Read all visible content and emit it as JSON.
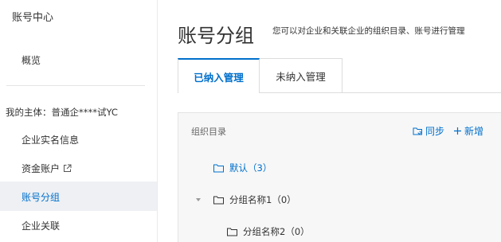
{
  "sidebar": {
    "title": "账号中心",
    "overview": "概览",
    "subject": "我的主体：普通企****试YC",
    "items": [
      {
        "label": "企业实名信息"
      },
      {
        "label": "资金账户"
      },
      {
        "label": "账号分组"
      },
      {
        "label": "企业关联"
      }
    ]
  },
  "header": {
    "title": "账号分组",
    "description": "您可以对企业和关联企业的组织目录、账号进行管理"
  },
  "tabs": [
    {
      "label": "已纳入管理"
    },
    {
      "label": "未纳入管理"
    }
  ],
  "panel": {
    "title": "组织目录",
    "sync_label": "同步",
    "add_label": "新增"
  },
  "tree": [
    {
      "label": "默认（3）"
    },
    {
      "label": "分组名称1（0）"
    },
    {
      "label": "分组名称2（0）"
    }
  ],
  "colors": {
    "accent": "#0070cc",
    "active_bg": "#eef0f4",
    "panel_bg": "#f7f7f7"
  }
}
